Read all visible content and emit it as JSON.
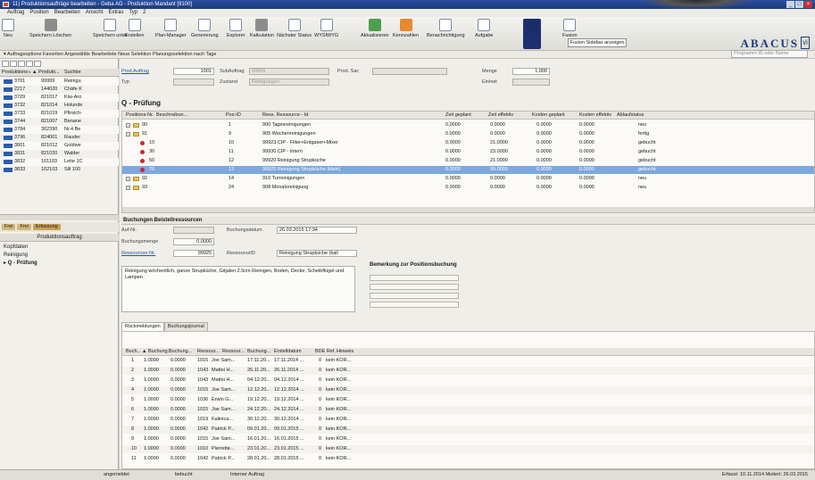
{
  "window": {
    "title": "11) Produktionsaufträge bearbeiten - Geba AG - Produktion Mandant [9100]"
  },
  "menu": [
    "Auftrag",
    "Position",
    "Bearbeiten",
    "Ansicht",
    "Extras",
    "Typ",
    "2"
  ],
  "toolbar": {
    "items": [
      {
        "label": "Neu",
        "icon": "new-doc-icon"
      },
      {
        "label": "Speichern Löschen",
        "icon": "delete-icon"
      },
      {
        "label": "Speichern unter",
        "icon": "save-as-icon"
      },
      {
        "label": "Erstellen",
        "icon": "create-icon"
      },
      {
        "label": "Plan-Manager",
        "icon": "plan-icon"
      },
      {
        "label": "Generierung",
        "icon": "generate-icon"
      },
      {
        "label": "Explorer",
        "icon": "explorer-icon"
      },
      {
        "label": "Kalkulation",
        "icon": "calc-icon"
      },
      {
        "label": "Nächster Status",
        "icon": "status-icon"
      },
      {
        "label": "WYSIWYG",
        "icon": "wysiwyg-icon"
      },
      {
        "label": "Aktualisieren",
        "icon": "refresh-icon"
      },
      {
        "label": "Kennzahlen",
        "icon": "kpi-icon"
      },
      {
        "label": "Benachrichtigung",
        "icon": "notify-icon"
      },
      {
        "label": "Aufgabe",
        "icon": "task-icon"
      },
      {
        "label": "",
        "icon": "active-view-icon"
      },
      {
        "label": "Fusion",
        "icon": "fusion-icon"
      }
    ],
    "row2": "▾ Auftragsoptione  Favoriten  Angewählte  Bearbeitete  Neue Selektion  Planungsselektion nach Tage",
    "sidebar_button": "Fusion Sidebar anzeigen",
    "search_placeholder": "Programm ID oder Name",
    "logo": "ABACUS",
    "logo_mark": "vi"
  },
  "left": {
    "columns": [
      "Produktions-A...",
      "▲ Produkt...",
      "Suchbe"
    ],
    "rows": [
      {
        "id": "3701",
        "prod": "99999",
        "search": "Reinigu"
      },
      {
        "id": "2217",
        "prod": "144020",
        "search": "Chäfe K"
      },
      {
        "id": "3729",
        "prod": "821017",
        "search": "Kiw-Aro"
      },
      {
        "id": "3732",
        "prod": "821014",
        "search": "Holunde"
      },
      {
        "id": "3733",
        "prod": "821019",
        "search": "Pfirsich-"
      },
      {
        "id": "3744",
        "prod": "821007",
        "search": "Banane"
      },
      {
        "id": "3784",
        "prod": "302390",
        "search": "Nr.4 Be"
      },
      {
        "id": "3796",
        "prod": "824001",
        "search": "Rauder"
      },
      {
        "id": "3801",
        "prod": "821012",
        "search": "Goldwe"
      },
      {
        "id": "3831",
        "prod": "821020",
        "search": "Walder"
      },
      {
        "id": "3832",
        "prod": "101103",
        "search": "Leite 1C"
      },
      {
        "id": "3833",
        "prod": "102103",
        "search": "Sill 100"
      }
    ],
    "tabs": [
      "Frei",
      "Frei",
      "Erfassung"
    ],
    "nav_title": "Produktionsauftrag",
    "nav": [
      "Kopfdaten",
      "Reinigung",
      "▸ Q - Prüfung"
    ]
  },
  "header_fields": {
    "auftrag_label": "Prod.Auftrag",
    "auftrag_value": "1001",
    "subauftrag_label": "SubAuftrag",
    "subauftrag_value": "99999",
    "prod_label": "Prod. Sac",
    "typ_label": "Typ",
    "typ_value": "",
    "zustand_label": "Zustand",
    "zustand_value": "Reinigungen",
    "menge_label": "Menge",
    "menge_value": "1.000",
    "einheit_label": "Einheit",
    "einheit_value": ""
  },
  "section_title": "Q - Prüfung",
  "pos_grid": {
    "columns": [
      "Positions-Nr.",
      "Beschreibun...",
      "Pos-ID",
      "Ress. Ressource - Id",
      "Zeit geplant",
      "Zeit effektiv",
      "Kosten geplant",
      "Kosten effektiv",
      "Ablaufstatus"
    ],
    "rows": [
      {
        "lvl": 1,
        "kind": "folder",
        "nr": "90",
        "pid": "1",
        "res": "900 Tagesreinigungen",
        "zg": "0.0000",
        "ze": "0.0000",
        "kg": "0.0000",
        "ke": "0.0000",
        "st": "neu"
      },
      {
        "lvl": 1,
        "kind": "folder",
        "nr": "91",
        "pid": "9",
        "res": "905 Wochenreinigungen",
        "zg": "0.0000",
        "ze": "0.0000",
        "kg": "0.0000",
        "ke": "0.0000",
        "st": "fertig"
      },
      {
        "lvl": 2,
        "kind": "red",
        "nr": "10",
        "pid": "10",
        "res": "99923 CIP - Filter+Entgaser+Mixer",
        "zg": "0.0000",
        "ze": "21.0000",
        "kg": "0.0000",
        "ke": "0.0000",
        "st": "gebucht"
      },
      {
        "lvl": 2,
        "kind": "red",
        "nr": "30",
        "pid": "11",
        "res": "99930 CIP - Intern",
        "zg": "0.0000",
        "ze": "23.0000",
        "kg": "0.0000",
        "ke": "0.0000",
        "st": "gebucht"
      },
      {
        "lvl": 2,
        "kind": "red",
        "nr": "50",
        "pid": "12",
        "res": "99920 Reinigung Strupküche",
        "zg": "0.0000",
        "ze": "21.0000",
        "kg": "0.0000",
        "ke": "0.0000",
        "st": "gebucht"
      },
      {
        "lvl": 2,
        "kind": "red",
        "nr": "70",
        "pid": "13",
        "res": "99925 Reinigung Strupküche (klein)",
        "zg": "0.0000",
        "ze": "99.0000",
        "kg": "0.0000",
        "ke": "0.0000",
        "st": "gebucht",
        "sel": true
      },
      {
        "lvl": 1,
        "kind": "folder",
        "nr": "92",
        "pid": "14",
        "res": "910 Turreinigungen",
        "zg": "0.0000",
        "ze": "0.0000",
        "kg": "0.0000",
        "ke": "0.0000",
        "st": "neu"
      },
      {
        "lvl": 1,
        "kind": "folder",
        "nr": "93",
        "pid": "24",
        "res": "908 Monatsreinigung",
        "zg": "0.0000",
        "ze": "0.0000",
        "kg": "0.0000",
        "ke": "0.0000",
        "st": "neu"
      }
    ]
  },
  "buchung": {
    "title": "Buchungen Beistellressourcen",
    "aufnr_label": "Auf-Nr.",
    "datum_label": "Buchungsdatum",
    "datum_value": "26.03.2015 17:34",
    "menge_label": "Buchungsmenge",
    "menge_value": "0.0000",
    "ressnr_label": "Ressourcen-Nr.",
    "ressnr_value": "99925",
    "ressid_label": "RessourceID",
    "ressid_value": "Reinigung Strupküche (kall",
    "notes": "Reinigung wöchentlich, ganze Strupküche, Gitjalen 2.5cm Reinigen, Boden, Decke, Scheibflügel und Lampen",
    "bemerk_title": "Bemerkung zur Positionsbuchung"
  },
  "tabs2": [
    "Rückmeldungen",
    "Buchungsjournal"
  ],
  "rueck": {
    "columns": [
      "Buch...",
      "▲ Buchung...",
      "Buchung...",
      "Ressour...",
      "Ressour...",
      "Buchung...",
      "Erstelldatum",
      "BDE Ref.",
      "Hinweis"
    ],
    "rows": [
      [
        "1",
        "1.0000",
        "0.0000",
        "1015",
        "Joe Sam...",
        "17.11.20...",
        "17.11.2014 ...",
        "0",
        "kein KOR..."
      ],
      [
        "2",
        "1.0000",
        "0.0000",
        "1043",
        "Mattei H...",
        "26.11.20...",
        "26.11.2014 ...",
        "0",
        "kein KOR..."
      ],
      [
        "3",
        "1.0000",
        "0.0000",
        "1043",
        "Mattei H...",
        "04.12.20...",
        "04.12.2014 ...",
        "0",
        "kein KOR..."
      ],
      [
        "4",
        "1.0000",
        "0.0000",
        "1015",
        "Joe Sam...",
        "12.12.20...",
        "12.12.2014 ...",
        "0",
        "kein KOR..."
      ],
      [
        "5",
        "1.0000",
        "0.0000",
        "1036",
        "Erwin G...",
        "19.12.20...",
        "19.12.2014 ...",
        "0",
        "kein KOR..."
      ],
      [
        "6",
        "1.0000",
        "0.0000",
        "1015",
        "Joe Sam...",
        "24.12.20...",
        "24.12.2014 ...",
        "0",
        "kein KOR..."
      ],
      [
        "7",
        "1.0000",
        "0.0000",
        "1019",
        "Kalinica...",
        "30.12.20...",
        "30.12.2014 ...",
        "0",
        "kein KOR..."
      ],
      [
        "8",
        "1.0000",
        "0.0000",
        "1042",
        "Patrick P...",
        "09.01.20...",
        "09.01.2015 ...",
        "0",
        "kein KOR..."
      ],
      [
        "9",
        "1.0000",
        "0.0000",
        "1015",
        "Joe Sam...",
        "16.01.20...",
        "16.01.2015 ...",
        "0",
        "kein KOR..."
      ],
      [
        "10",
        "1.0000",
        "0.0000",
        "1010",
        "Pierrette...",
        "23.01.20...",
        "23.01.2015 ...",
        "0",
        "kein KOR..."
      ],
      [
        "11",
        "1.0000",
        "0.0000",
        "1042",
        "Patrick P...",
        "28.01.20...",
        "28.01.2015 ...",
        "0",
        "kein KOR..."
      ]
    ]
  },
  "status": {
    "left1": "angemeldet",
    "left2": "bebucht",
    "left3": "Interner Auftrag",
    "right": "Erfasst: 10.11.2014  Mutiert: 26.03.2015"
  },
  "colors": {
    "title_bar": "#1c3b80",
    "selection": "#7da8df",
    "active_tab": "#1d2f6e"
  }
}
